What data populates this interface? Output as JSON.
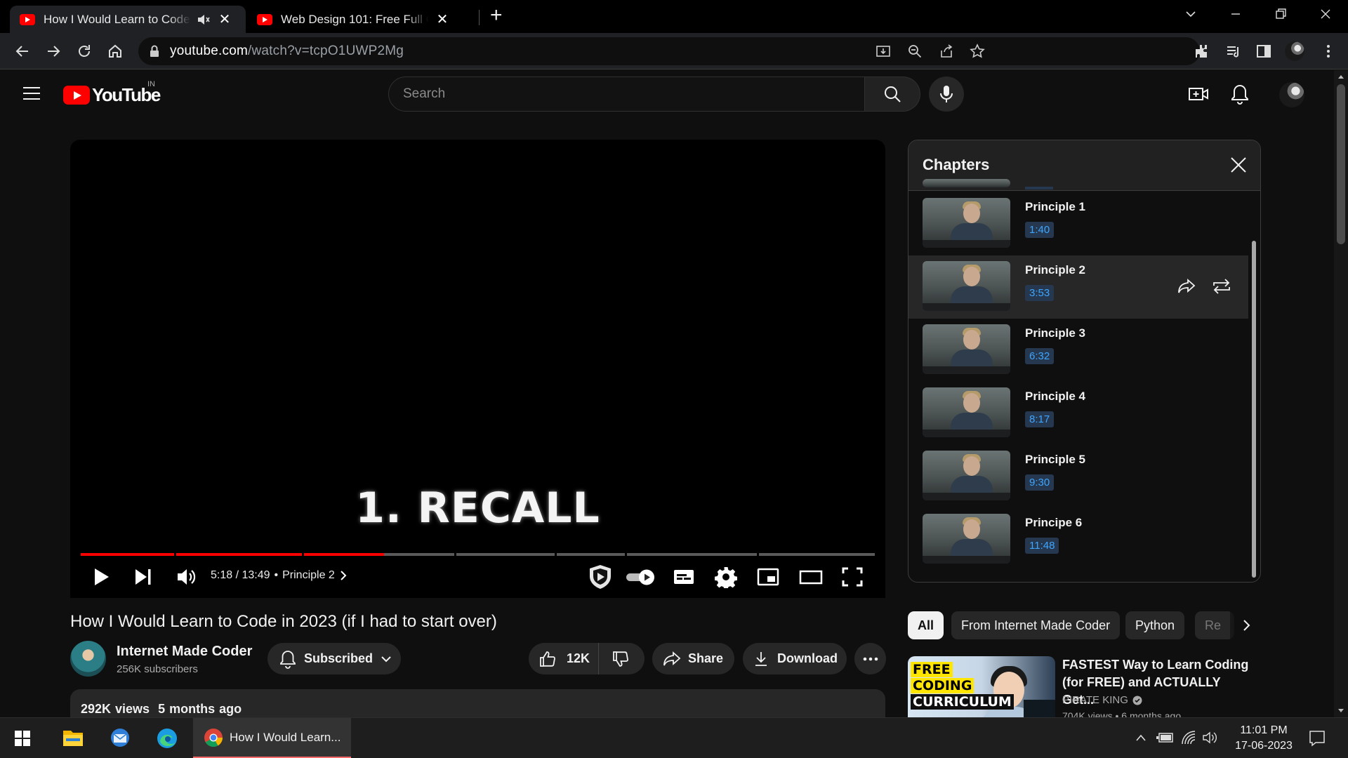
{
  "browser": {
    "tabs": [
      {
        "title": "How I Would Learn to Code in 2023 (if I had to start over)",
        "active": true,
        "muted": true
      },
      {
        "title": "Web Design 101: Free Full Course",
        "active": false
      }
    ],
    "new_tab": "+",
    "url_host": "youtube.com",
    "url_path": "/watch?v=tcpO1UWP2Mg"
  },
  "yt": {
    "logo_text": "YouTube",
    "region": "IN",
    "search_placeholder": "Search"
  },
  "player": {
    "overlay_text": "1. RECALL",
    "time": "5:18 / 13:49",
    "separator": "•",
    "chapter": "Principle 2",
    "progress": {
      "duration_seconds": 829,
      "position_seconds": 318,
      "chapter_starts_seconds": [
        0,
        100,
        233,
        392,
        497,
        570,
        708
      ]
    }
  },
  "video": {
    "title": "How I Would Learn to Code in 2023 (if I had to start over)",
    "channel": "Internet Made Coder",
    "subscribers": "256K subscribers",
    "subscribed_label": "Subscribed",
    "likes": "12K",
    "share_label": "Share",
    "download_label": "Download",
    "views": "292K views",
    "age": "5 months ago"
  },
  "chapters": {
    "title": "Chapters",
    "items": [
      {
        "title": "Principle 1",
        "time": "1:40"
      },
      {
        "title": "Principle 2",
        "time": "3:53",
        "active": true
      },
      {
        "title": "Principle 3",
        "time": "6:32"
      },
      {
        "title": "Principle 4",
        "time": "8:17"
      },
      {
        "title": "Principle 5",
        "time": "9:30"
      },
      {
        "title": "Principe 6",
        "time": "11:48"
      }
    ]
  },
  "chips": [
    "All",
    "From Internet Made Coder",
    "Python",
    "Re"
  ],
  "recommended": {
    "title": "FASTEST Way to Learn Coding (for FREE) and ACTUALLY Get...",
    "channel": "PIRATE KING",
    "meta": "704K views • 6 months ago",
    "thumb_badge": [
      "FREE",
      "CODING",
      "CURRICULUM"
    ]
  },
  "taskbar": {
    "chrome_label": "How I Would Learn...",
    "time": "11:01 PM",
    "date": "17-06-2023"
  }
}
